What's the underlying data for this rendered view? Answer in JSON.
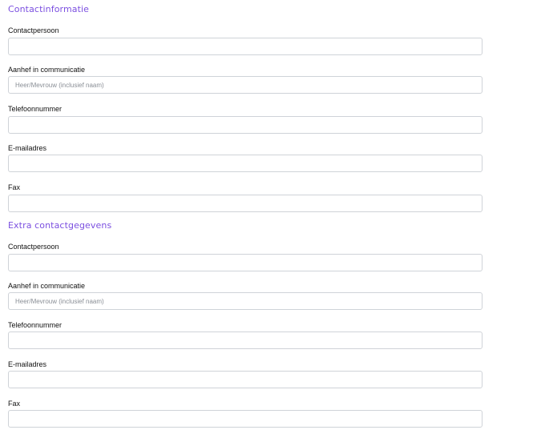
{
  "sections": [
    {
      "title": "Contactinformatie",
      "fields": [
        {
          "label": "Contactpersoon",
          "value": "",
          "placeholder": ""
        },
        {
          "label": "Aanhef in communicatie",
          "value": "",
          "placeholder": "Heer/Mevrouw (inclusief naam)"
        },
        {
          "label": "Telefoonnummer",
          "value": "",
          "placeholder": ""
        },
        {
          "label": "E-mailadres",
          "value": "",
          "placeholder": ""
        },
        {
          "label": "Fax",
          "value": "",
          "placeholder": ""
        }
      ]
    },
    {
      "title": "Extra contactgegevens",
      "fields": [
        {
          "label": "Contactpersoon",
          "value": "",
          "placeholder": ""
        },
        {
          "label": "Aanhef in communicatie",
          "value": "",
          "placeholder": "Heer/Mevrouw (inclusief naam)"
        },
        {
          "label": "Telefoonnummer",
          "value": "",
          "placeholder": ""
        },
        {
          "label": "E-mailadres",
          "value": "",
          "placeholder": ""
        },
        {
          "label": "Fax",
          "value": "",
          "placeholder": ""
        }
      ]
    }
  ],
  "colors": {
    "section_title": "#7b4fe0",
    "input_border": "#cfd3d8"
  }
}
